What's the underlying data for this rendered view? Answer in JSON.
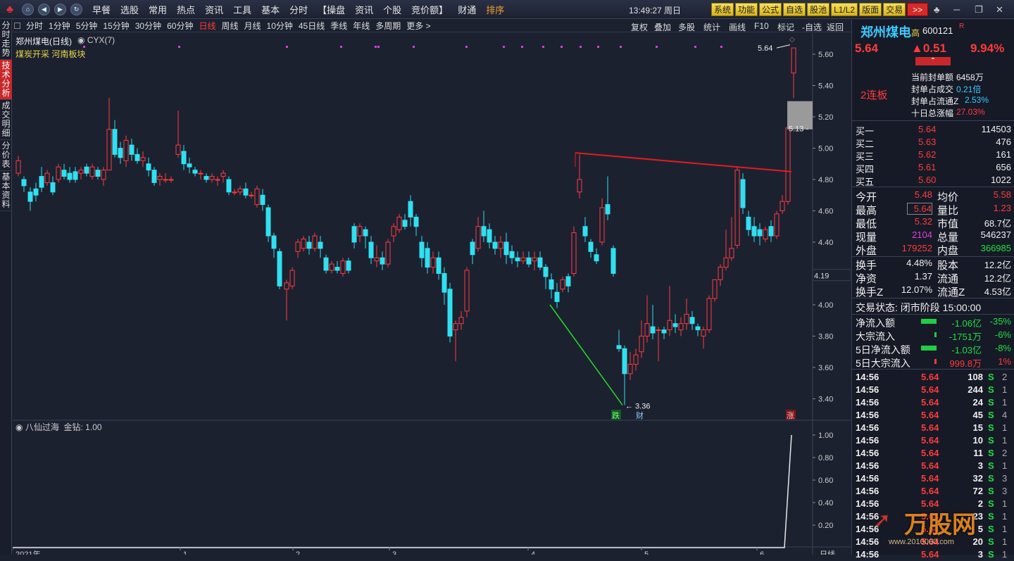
{
  "topbar": {
    "menus": [
      "早餐",
      "选股",
      "常用",
      "热点",
      "资讯",
      "工具",
      "基本",
      "分时",
      "【操盘",
      "资讯",
      "个股",
      "竞价额】",
      "财通",
      "排序"
    ],
    "clock": "13:49:27 周日",
    "right_buttons": [
      "系统",
      "功能",
      "公式",
      "自选",
      "股池",
      "L1/L2",
      "版面",
      "交易"
    ],
    "more_button": ">>"
  },
  "left_tabs": [
    "分时走势",
    "技术分析",
    "成交明细",
    "分价表",
    "基本资料"
  ],
  "periods": [
    "分时",
    "1分钟",
    "5分钟",
    "15分钟",
    "30分钟",
    "60分钟",
    "日线",
    "周线",
    "月线",
    "10分钟",
    "45日线",
    "季线",
    "年线",
    "多周期",
    "更多 >"
  ],
  "tools": [
    "复权",
    "叠加",
    "多股",
    "统计",
    "画线",
    "F10",
    "标记",
    "-自选",
    "返回"
  ],
  "chart": {
    "stock_label": "郑州煤电(日线)",
    "indicator_label": "CYX(7)",
    "sector_tags": "煤炭开采 河南板块",
    "high_label": "5.64",
    "low_label": "3.36",
    "mid_label": "5.13",
    "current_axis_value": "4.19",
    "y_ticks": [
      "5.60",
      "5.40",
      "5.20",
      "5.00",
      "4.80",
      "4.60",
      "4.40",
      "4.20",
      "4.00",
      "3.80",
      "3.60",
      "3.40"
    ],
    "x_ticks": [
      "2021年",
      "1",
      "2",
      "3",
      "4",
      "5",
      "6"
    ],
    "markers": {
      "die": "跌",
      "cai": "财",
      "zhang": "涨"
    }
  },
  "sub_chart": {
    "label": "八仙过海",
    "value_label": "金钻: 1.00",
    "y_ticks": [
      "1.00",
      "0.80",
      "0.60",
      "0.40",
      "0.20"
    ],
    "axis_unit": "日线"
  },
  "quote": {
    "name": "郑州煤电",
    "suffix": "高",
    "code": "600121",
    "flag": "R",
    "price": "5.64",
    "change": "▲0.51",
    "change_pct": "9.94%",
    "limit_up": "2连板",
    "seal_info": [
      {
        "label": "当前封单额",
        "value": "6458万"
      },
      {
        "label": "封单占成交",
        "value": "0.21倍"
      },
      {
        "label": "封单占流通Z",
        "value": "2.53%"
      },
      {
        "label": "十日总涨幅",
        "value": "27.03%"
      }
    ],
    "bids": [
      {
        "label": "买一",
        "price": "5.64",
        "vol": "114503"
      },
      {
        "label": "买二",
        "price": "5.63",
        "vol": "476"
      },
      {
        "label": "买三",
        "price": "5.62",
        "vol": "161"
      },
      {
        "label": "买四",
        "price": "5.61",
        "vol": "656"
      },
      {
        "label": "买五",
        "price": "5.60",
        "vol": "1022"
      }
    ],
    "stats": [
      {
        "l1": "今开",
        "v1": "5.48",
        "l2": "均价",
        "v2": "5.58"
      },
      {
        "l1": "最高",
        "v1": "5.64",
        "l2": "量比",
        "v2": "1.23"
      },
      {
        "l1": "最低",
        "v1": "5.32",
        "l2": "市值",
        "v2": "68.7亿"
      },
      {
        "l1": "现量",
        "v1": "2104",
        "l2": "总量",
        "v2": "546237"
      },
      {
        "l1": "外盘",
        "v1": "179252",
        "l2": "内盘",
        "v2": "366985"
      }
    ],
    "stats2": [
      {
        "l1": "换手",
        "v1": "4.48%",
        "l2": "股本",
        "v2": "12.2亿"
      },
      {
        "l1": "净资",
        "v1": "1.37",
        "l2": "流通",
        "v2": "12.2亿"
      },
      {
        "l1": "换手Z",
        "v1": "12.07%",
        "l2": "流通Z",
        "v2": "4.53亿"
      }
    ],
    "trade_status": "交易状态: 闭市阶段 15:00:00",
    "flows": [
      {
        "label": "净流入额",
        "value": "-1.06亿",
        "pct": "-35%"
      },
      {
        "label": "大宗流入",
        "value": "-1751万",
        "pct": "-6%"
      },
      {
        "label": "5日净流入额",
        "value": "-1.03亿",
        "pct": "-8%"
      },
      {
        "label": "5日大宗流入",
        "value": "999.8万",
        "pct": "1%"
      }
    ],
    "ticks": [
      {
        "t": "14:56",
        "p": "5.64",
        "v": "108",
        "s": "S",
        "n": "2"
      },
      {
        "t": "14:56",
        "p": "5.64",
        "v": "244",
        "s": "S",
        "n": "1"
      },
      {
        "t": "14:56",
        "p": "5.64",
        "v": "24",
        "s": "S",
        "n": "1"
      },
      {
        "t": "14:56",
        "p": "5.64",
        "v": "45",
        "s": "S",
        "n": "4"
      },
      {
        "t": "14:56",
        "p": "5.64",
        "v": "15",
        "s": "S",
        "n": "1"
      },
      {
        "t": "14:56",
        "p": "5.64",
        "v": "10",
        "s": "S",
        "n": "1"
      },
      {
        "t": "14:56",
        "p": "5.64",
        "v": "11",
        "s": "S",
        "n": "2"
      },
      {
        "t": "14:56",
        "p": "5.64",
        "v": "3",
        "s": "S",
        "n": "1"
      },
      {
        "t": "14:56",
        "p": "5.64",
        "v": "32",
        "s": "S",
        "n": "3"
      },
      {
        "t": "14:56",
        "p": "5.64",
        "v": "72",
        "s": "S",
        "n": "3"
      },
      {
        "t": "14:56",
        "p": "5.64",
        "v": "2",
        "s": "S",
        "n": "1"
      },
      {
        "t": "14:56",
        "p": "5.64",
        "v": "23",
        "s": "S",
        "n": "1"
      },
      {
        "t": "14:56",
        "p": "5.64",
        "v": "5",
        "s": "S",
        "n": "1"
      },
      {
        "t": "14:56",
        "p": "5.64",
        "v": "20",
        "s": "S",
        "n": "1"
      },
      {
        "t": "14:56",
        "p": "5.64",
        "v": "3",
        "s": "S",
        "n": "1"
      }
    ]
  },
  "watermark": {
    "text": "万股网",
    "url": "www.2010000.com"
  }
}
